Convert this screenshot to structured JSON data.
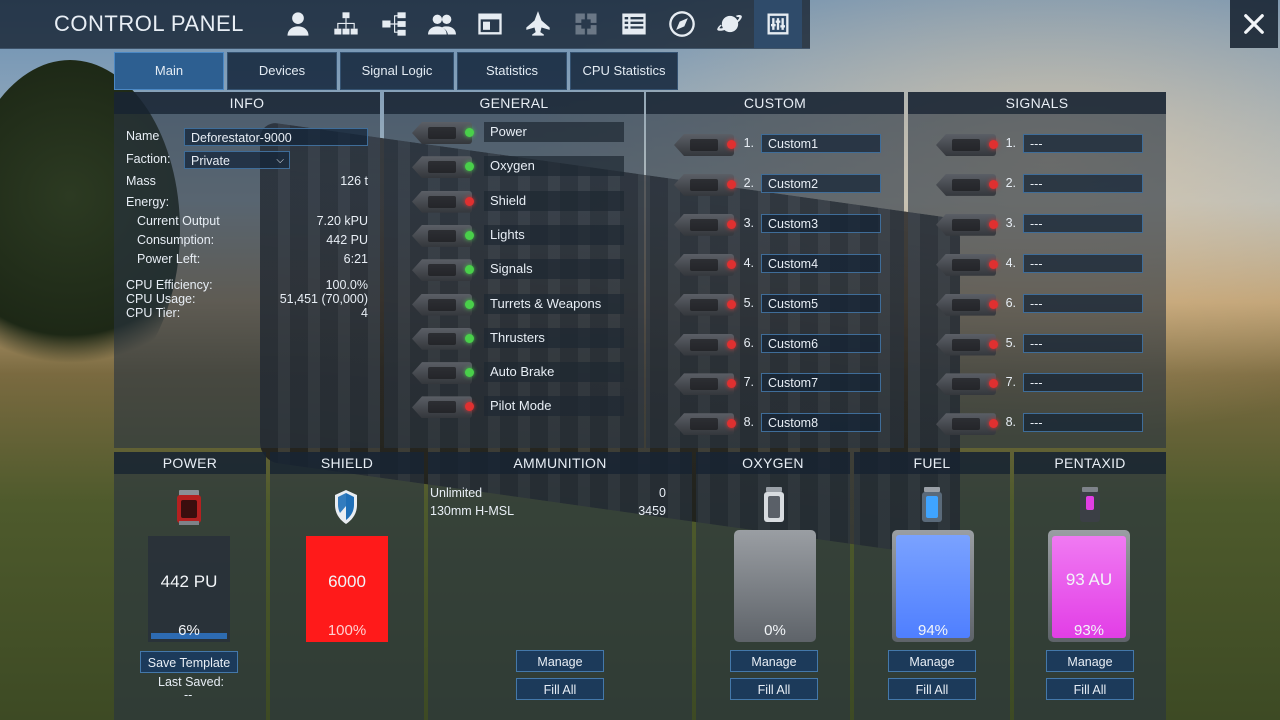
{
  "window": {
    "title": "CONTROL PANEL"
  },
  "nav_icons": [
    {
      "name": "player-icon",
      "state": "normal"
    },
    {
      "name": "network-icon",
      "state": "normal"
    },
    {
      "name": "structure-tree-icon",
      "state": "normal"
    },
    {
      "name": "group-icon",
      "state": "normal"
    },
    {
      "name": "window-icon",
      "state": "normal"
    },
    {
      "name": "ship-icon",
      "state": "normal"
    },
    {
      "name": "puzzle-icon",
      "state": "disabled"
    },
    {
      "name": "list-icon",
      "state": "normal"
    },
    {
      "name": "compass-icon",
      "state": "normal"
    },
    {
      "name": "planet-icon",
      "state": "normal"
    },
    {
      "name": "control-panel-sliders-icon",
      "state": "active"
    }
  ],
  "tabs": [
    {
      "label": "Main",
      "active": true
    },
    {
      "label": "Devices",
      "active": false
    },
    {
      "label": "Signal Logic",
      "active": false
    },
    {
      "label": "Statistics",
      "active": false
    },
    {
      "label": "CPU Statistics",
      "active": false
    }
  ],
  "info": {
    "header": "INFO",
    "name_label": "Name",
    "name_value": "Deforestator-9000",
    "faction_label": "Faction:",
    "faction_value": "Private",
    "mass_label": "Mass",
    "mass_value": "126 t",
    "energy_label": "Energy:",
    "current_output_label": "Current Output",
    "current_output_value": "7.20 kPU",
    "consumption_label": "Consumption:",
    "consumption_value": "442 PU",
    "power_left_label": "Power Left:",
    "power_left_value": "6:21",
    "cpu_efficiency_label": "CPU Efficiency:",
    "cpu_efficiency_value": "100.0%",
    "cpu_usage_label": "CPU Usage:",
    "cpu_usage_value": "51,451  (70,000)",
    "cpu_tier_label": "CPU Tier:",
    "cpu_tier_value": "4"
  },
  "general": {
    "header": "GENERAL",
    "items": [
      {
        "label": "Power",
        "on": true
      },
      {
        "label": "Oxygen",
        "on": true
      },
      {
        "label": "Shield",
        "on": false
      },
      {
        "label": "Lights",
        "on": true
      },
      {
        "label": "Signals",
        "on": true
      },
      {
        "label": "Turrets & Weapons",
        "on": true
      },
      {
        "label": "Thrusters",
        "on": true
      },
      {
        "label": "Auto Brake",
        "on": true
      },
      {
        "label": "Pilot Mode",
        "on": false
      }
    ]
  },
  "custom": {
    "header": "CUSTOM",
    "items": [
      {
        "num": "1.",
        "value": "Custom1"
      },
      {
        "num": "2.",
        "value": "Custom2"
      },
      {
        "num": "3.",
        "value": "Custom3"
      },
      {
        "num": "4.",
        "value": "Custom4"
      },
      {
        "num": "5.",
        "value": "Custom5"
      },
      {
        "num": "6.",
        "value": "Custom6"
      },
      {
        "num": "7.",
        "value": "Custom7"
      },
      {
        "num": "8.",
        "value": "Custom8"
      }
    ]
  },
  "signals": {
    "header": "SIGNALS",
    "items": [
      {
        "num": "1.",
        "value": "---"
      },
      {
        "num": "2.",
        "value": "---"
      },
      {
        "num": "3.",
        "value": "---"
      },
      {
        "num": "4.",
        "value": "---"
      },
      {
        "num": "6.",
        "value": "---"
      },
      {
        "num": "5.",
        "value": "---"
      },
      {
        "num": "7.",
        "value": "---"
      },
      {
        "num": "8.",
        "value": "---"
      }
    ]
  },
  "power": {
    "header": "POWER",
    "value": "442 PU",
    "percent": "6%",
    "fill": 0.06,
    "save_template_label": "Save Template",
    "last_saved_label": "Last Saved:",
    "last_saved_value": "--"
  },
  "shield": {
    "header": "SHIELD",
    "value": "6000",
    "percent": "100%",
    "fill": 1.0,
    "color": "#ff1a1a"
  },
  "ammunition": {
    "header": "AMMUNITION",
    "rows": [
      {
        "label": "Unlimited",
        "value": "0"
      },
      {
        "label": "130mm H-MSL",
        "value": "3459"
      }
    ],
    "manage_label": "Manage",
    "fill_all_label": "Fill All"
  },
  "oxygen": {
    "header": "OXYGEN",
    "value": "",
    "percent": "0%",
    "fill": 0.0,
    "manage_label": "Manage",
    "fill_all_label": "Fill All"
  },
  "fuel": {
    "header": "FUEL",
    "value": "",
    "percent": "94%",
    "fill": 0.94,
    "color": "#4f7fff",
    "manage_label": "Manage",
    "fill_all_label": "Fill All"
  },
  "pentaxid": {
    "header": "PENTAXID",
    "value": "93 AU",
    "percent": "93%",
    "fill": 0.93,
    "color": "#e23ee6",
    "manage_label": "Manage",
    "fill_all_label": "Fill All"
  },
  "colors": {
    "accent": "#2d5f91",
    "led_on": "#49d04a",
    "led_off": "#e03030"
  }
}
